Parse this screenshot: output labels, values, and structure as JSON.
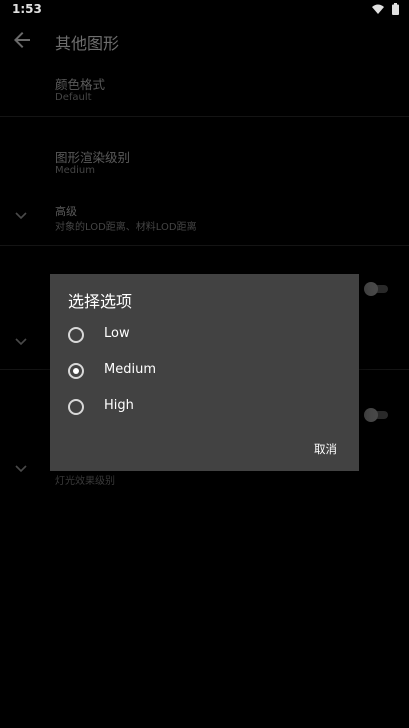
{
  "status_bar": {
    "time": "1:53",
    "icons": [
      "wifi-icon",
      "battery-icon"
    ]
  },
  "app_bar": {
    "title": "其他图形",
    "back_icon": "arrow-back-icon"
  },
  "settings": {
    "color_format": {
      "title": "颜色格式",
      "summary": "Default"
    },
    "render_level": {
      "title": "图形渲染级别",
      "summary": "Medium"
    },
    "advanced": {
      "title": "高级",
      "summary": "对象的LOD距离、材料LOD距离"
    },
    "lighting": {
      "summary": "灯光效果级别"
    }
  },
  "dialog": {
    "title": "选择选项",
    "options": [
      {
        "label": "Low",
        "selected": false
      },
      {
        "label": "Medium",
        "selected": true
      },
      {
        "label": "High",
        "selected": false
      }
    ],
    "cancel_label": "取消"
  },
  "colors": {
    "background": "#000000",
    "dialog_background": "#424242",
    "dialog_text": "#ffffff"
  }
}
